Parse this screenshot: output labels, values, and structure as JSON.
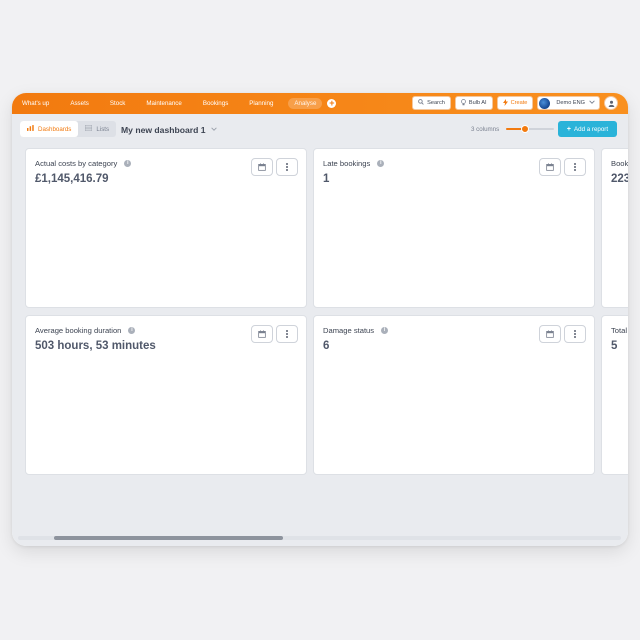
{
  "nav": {
    "items": [
      "What's up",
      "Assets",
      "Stock",
      "Maintenance",
      "Bookings",
      "Planning",
      "Analyse"
    ],
    "active": "Analyse"
  },
  "topbar": {
    "search_label": "Search",
    "bulb_label": "Bulb AI",
    "create_label": "Create",
    "account_label": "Demo ENG"
  },
  "toolbar": {
    "tab_dashboards": "Dashboards",
    "tab_lists": "Lists",
    "dashboard_title": "My new dashboard 1",
    "columns_label": "3 columns",
    "columns_slider_fraction": 0.4,
    "add_report_label": "Add a report"
  },
  "cards": [
    {
      "title": "Actual costs by category",
      "value": "£1,145,416.79"
    },
    {
      "title": "Late bookings",
      "value": "1"
    },
    {
      "title": "Booki",
      "value": "223"
    },
    {
      "title": "Average booking duration",
      "value": "503 hours, 53 minutes"
    },
    {
      "title": "Damage status",
      "value": "6"
    },
    {
      "title": "Total",
      "value": "5"
    }
  ],
  "scroll": {
    "thumb_start_fraction": 0.06,
    "thumb_size_fraction": 0.38
  },
  "colors": {
    "brand_orange": "#f27a0f",
    "accent_cyan": "#2ab3d9",
    "background": "#e9ebef"
  }
}
